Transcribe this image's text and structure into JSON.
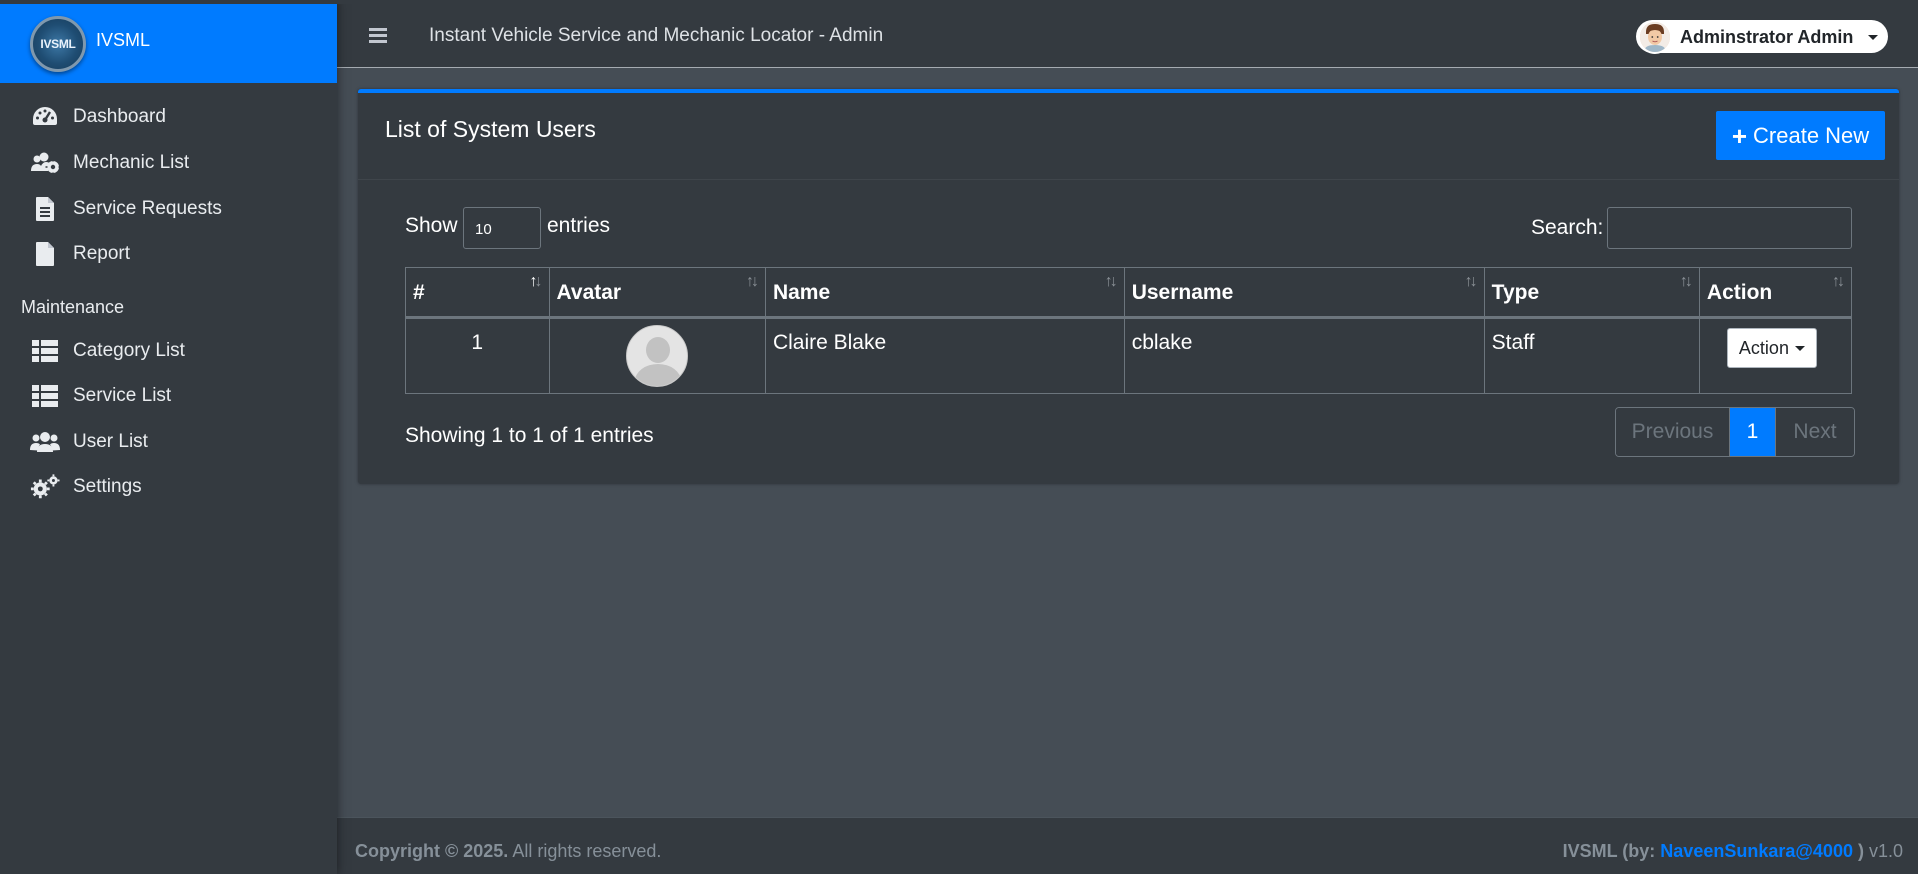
{
  "brand": {
    "logo_text": "IVSML",
    "name": "IVSML"
  },
  "sidebar": {
    "items": [
      {
        "label": "Dashboard",
        "icon": "tachometer-icon"
      },
      {
        "label": "Mechanic List",
        "icon": "users-cog-icon"
      },
      {
        "label": "Service Requests",
        "icon": "file-list-icon"
      },
      {
        "label": "Report",
        "icon": "file-icon"
      }
    ],
    "section_header": "Maintenance",
    "maintenance_items": [
      {
        "label": "Category List",
        "icon": "table-list-icon"
      },
      {
        "label": "Service List",
        "icon": "table-list-icon"
      },
      {
        "label": "User List",
        "icon": "users-icon"
      },
      {
        "label": "Settings",
        "icon": "cogs-icon"
      }
    ]
  },
  "header": {
    "title": "Instant Vehicle Service and Mechanic Locator - Admin",
    "user_name": "Adminstrator Admin"
  },
  "card": {
    "title": "List of System Users",
    "create_button": "Create New"
  },
  "datatable": {
    "show_label": "Show",
    "entries_value": "10",
    "entries_label": "entries",
    "search_label": "Search:",
    "search_value": "",
    "columns": [
      "#",
      "Avatar",
      "Name",
      "Username",
      "Type",
      "Action"
    ],
    "rows": [
      {
        "num": "1",
        "name": "Claire Blake",
        "username": "cblake",
        "type": "Staff",
        "action": "Action"
      }
    ],
    "info": "Showing 1 to 1 of 1 entries",
    "pagination": {
      "previous": "Previous",
      "current": "1",
      "next": "Next"
    }
  },
  "footer": {
    "copyright": "Copyright © 2025.",
    "rights": " All rights reserved.",
    "right_prefix": "IVSML (by: ",
    "author": "NaveenSunkara@4000",
    "right_suffix": " )",
    "version": " v1.0"
  },
  "colors": {
    "accent": "#007bff",
    "sidebar_bg": "#343a40",
    "content_bg": "#454d55"
  }
}
